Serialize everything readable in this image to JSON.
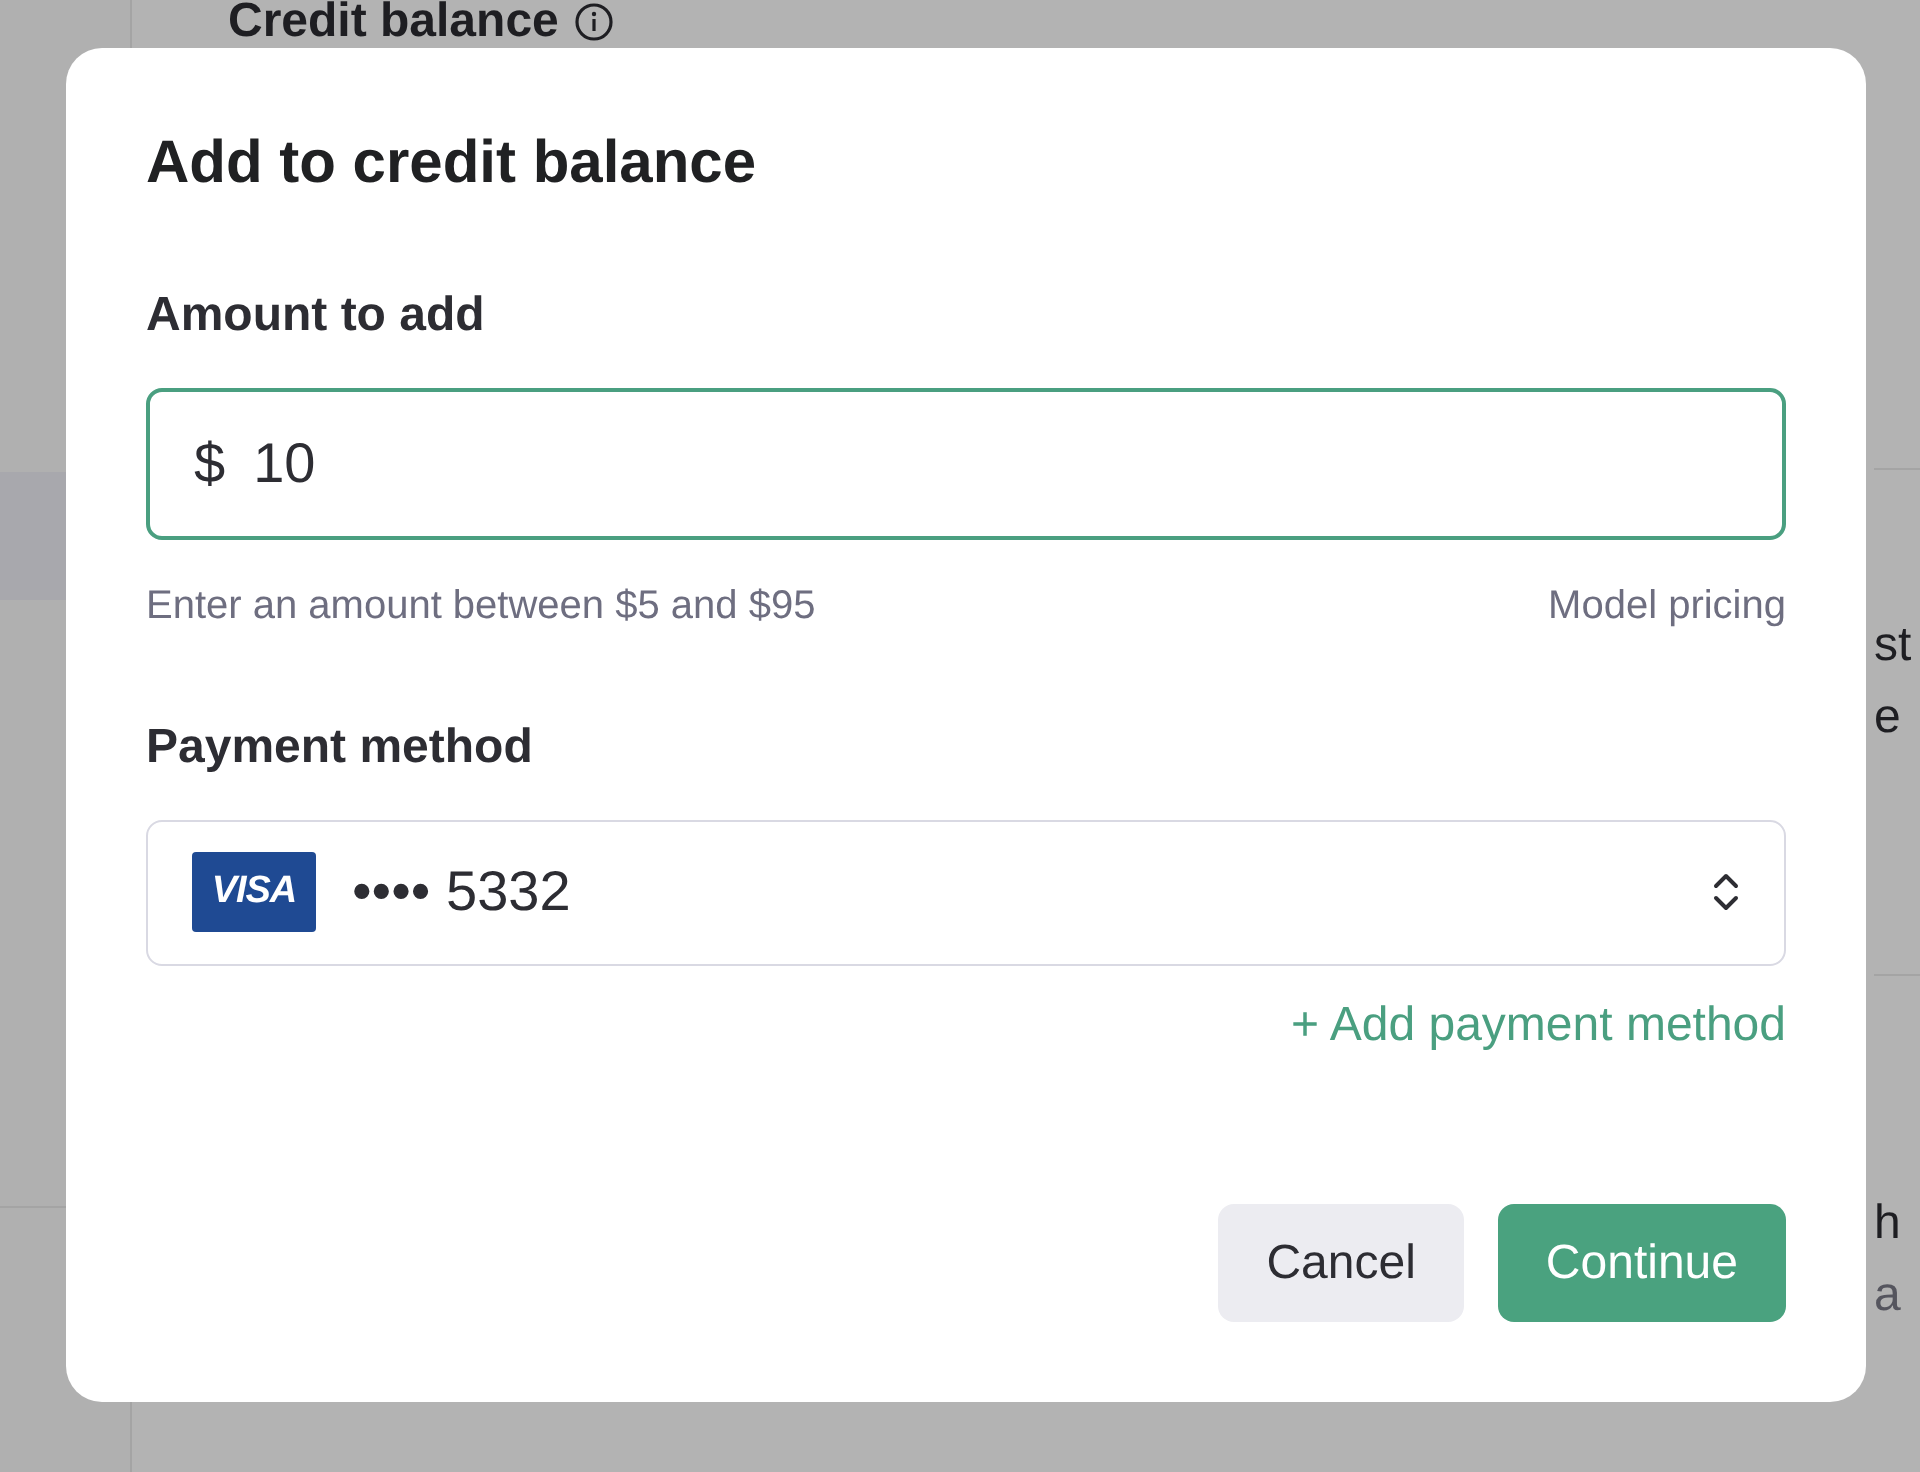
{
  "background": {
    "heading": "Credit balance",
    "fragments": [
      {
        "text": "st"
      },
      {
        "text": "e"
      },
      {
        "text": "h"
      },
      {
        "text": "a"
      }
    ]
  },
  "dialog": {
    "title": "Add to credit balance",
    "amount": {
      "label": "Amount to add",
      "currency": "$",
      "value": "10"
    },
    "hint": "Enter an amount between $5 and $95",
    "pricing_link": "Model pricing",
    "payment": {
      "label": "Payment method",
      "brand": "VISA",
      "masked": "•••• 5332"
    },
    "add_payment": "+ Add payment method",
    "buttons": [
      {
        "label": "Cancel",
        "kind": "secondary"
      },
      {
        "label": "Continue",
        "kind": "primary"
      }
    ]
  }
}
